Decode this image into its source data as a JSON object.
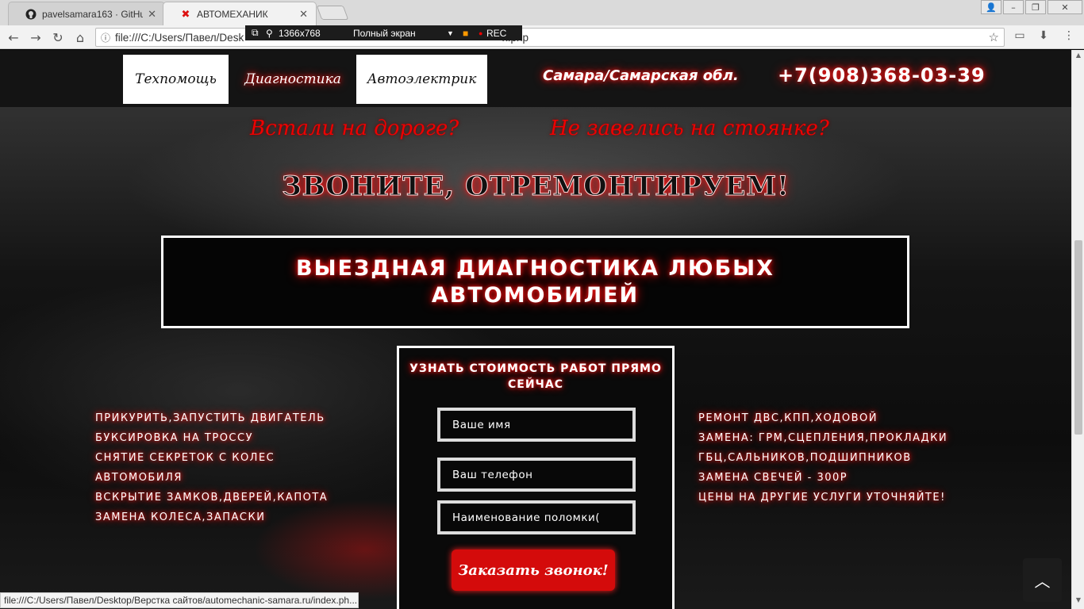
{
  "browser": {
    "tabs": [
      {
        "title": "pavelsamara163 · GitHub",
        "icon": "github-icon"
      },
      {
        "title": "АВТОМЕХАНИК",
        "icon": "site-favicon"
      }
    ],
    "address": "file:///C:/Users/Павел/Desk",
    "address_tail": "x.php",
    "status_url": "file:///C:/Users/Павел/Desktop/Верстка сайтов/automechanic-samara.ru/index.ph...",
    "recorder": {
      "size": "1366x768",
      "mode": "Полный экран",
      "rec": "REC"
    }
  },
  "header": {
    "menu": [
      {
        "label": "Техпомощь"
      },
      {
        "label": "Диагностика"
      },
      {
        "label": "Автоэлектрик"
      }
    ],
    "region": "Самара/Самарская обл.",
    "phone": "+7(908)368-03-39"
  },
  "hero": {
    "question1": "Встали на дороге?",
    "question2": "Не завелись на стоянке?",
    "slogan": "ЗВОНИТЕ, ОТРЕМОНТИРУЕМ!",
    "banner": "ВЫЕЗДНАЯ ДИАГНОСТИКА ЛЮБЫХ АВТОМОБИЛЕЙ"
  },
  "services_left": [
    "ПРИКУРИТЬ,ЗАПУСТИТЬ ДВИГАТЕЛЬ",
    "БУКСИРОВКА НА ТРОССУ",
    "СНЯТИЕ СЕКРЕТОК С КОЛЕС",
    "АВТОМОБИЛЯ",
    "ВСКРЫТИЕ ЗАМКОВ,ДВЕРЕЙ,КАПОТА",
    "ЗАМЕНА КОЛЕСА,ЗАПАСКИ"
  ],
  "services_right": [
    "РЕМОНТ ДВС,КПП,ХОДОВОЙ",
    "ЗАМЕНА: ГРМ,СЦЕПЛЕНИЯ,ПРОКЛАДКИ",
    "ГБЦ,САЛЬНИКОВ,ПОДШИПНИКОВ",
    "ЗАМЕНА СВЕЧЕЙ - 300Р",
    "ЦЕНЫ НА ДРУГИЕ УСЛУГИ УТОЧНЯЙТЕ!"
  ],
  "form": {
    "title": "УЗНАТЬ СТОИМОСТЬ РАБОТ ПРЯМО СЕЙЧАС",
    "name_placeholder": "Ваше имя",
    "phone_placeholder": "Ваш телефон",
    "problem_placeholder": "Наименование поломки(",
    "submit": "Заказать звонок!"
  },
  "colors": {
    "accent_red": "#e00000",
    "button_red": "#d40b0b"
  }
}
